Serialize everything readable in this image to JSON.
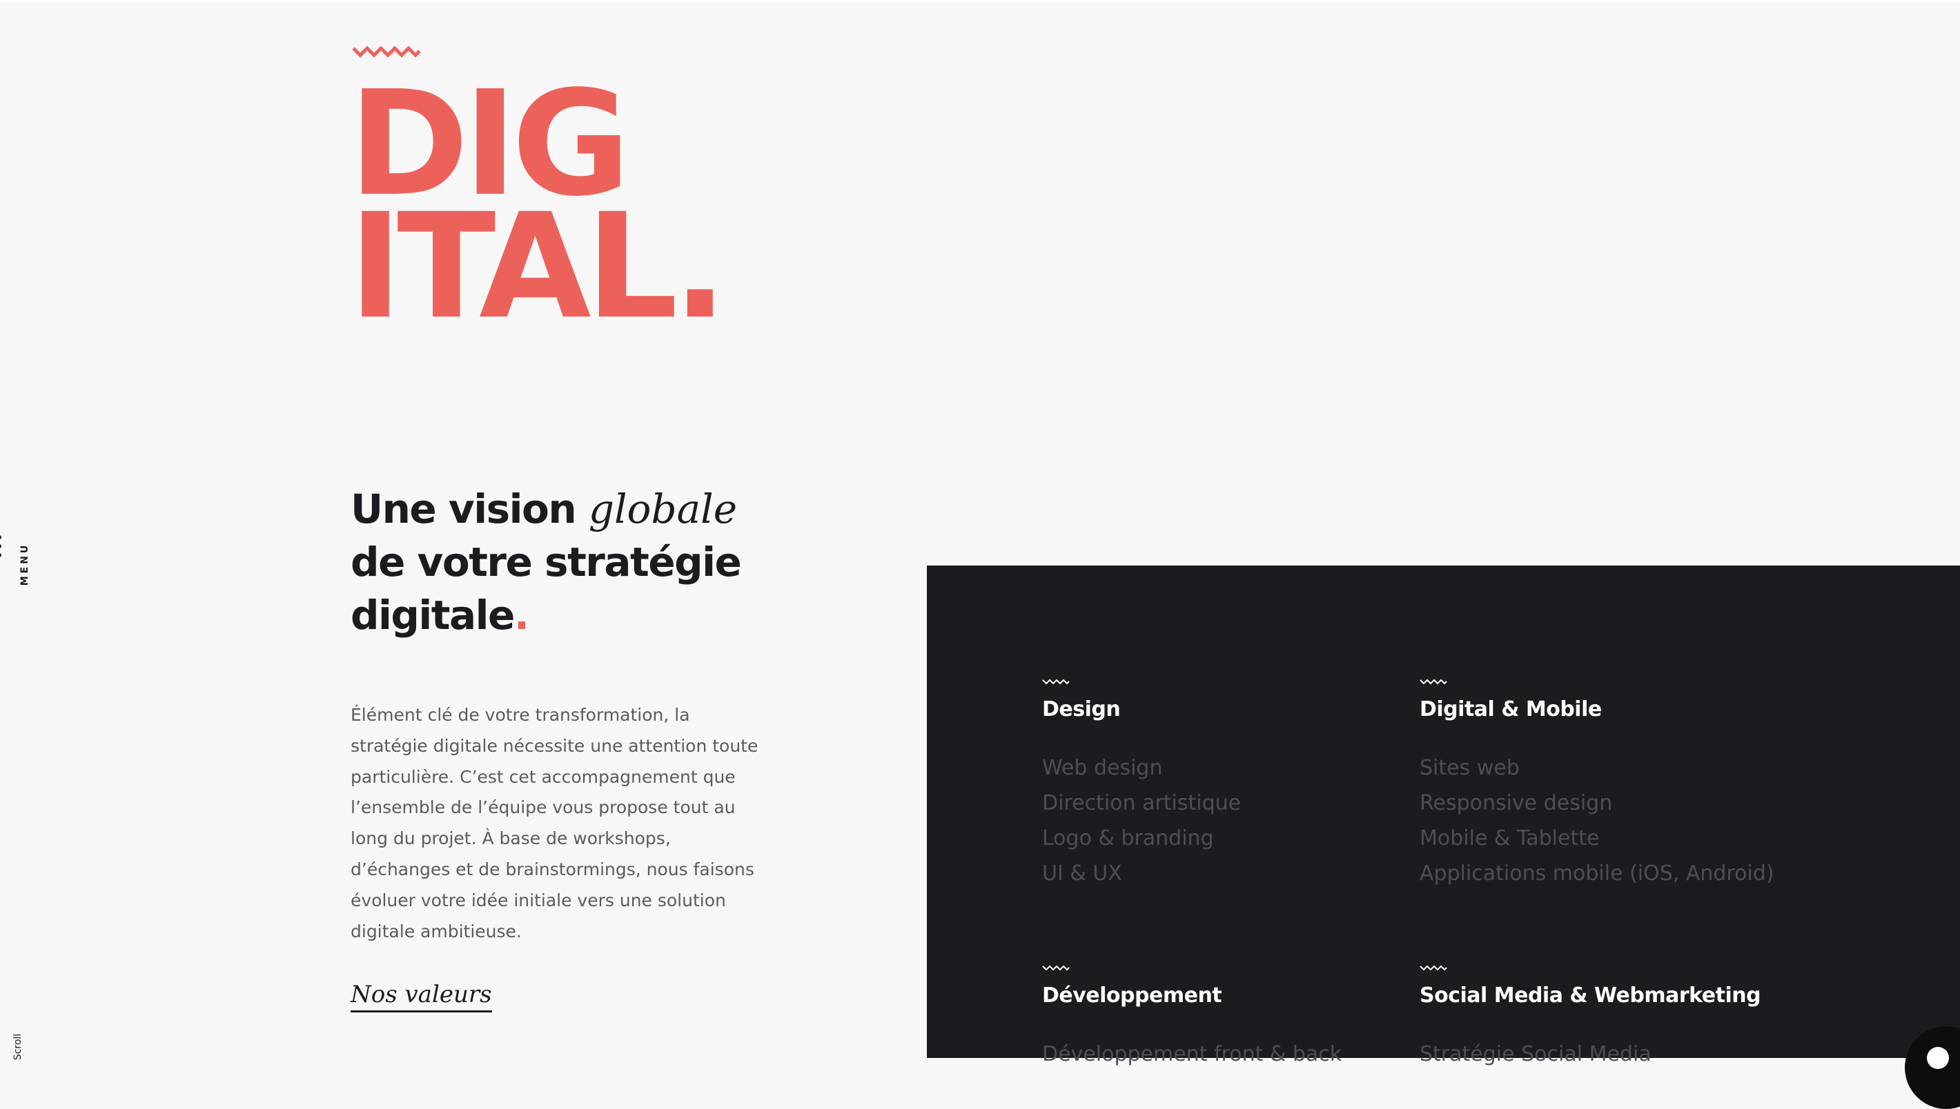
{
  "colors": {
    "accent": "#ec625b",
    "dark": "#1c1b20",
    "background": "#f7f7f7",
    "panel_text_muted": "#4f4e55"
  },
  "side": {
    "menu_icon": "menu-dots-icon",
    "menu_label": "MENU",
    "scroll_label": "Scroll"
  },
  "hero": {
    "line1": "DIG",
    "line2": "ITAL."
  },
  "vision": {
    "part1": "Une vision ",
    "italic": "globale",
    "part2": "de votre stratégie",
    "part3": "digitale",
    "dot": "."
  },
  "intro": {
    "text": "Élément clé de votre transformation, la stratégie digitale nécessite une attention toute particulière. C’est cet accompagnement que l’ensemble de l’équipe vous propose tout au long du projet. À base de workshops, d’échanges et de brainstormings, nous faisons évoluer votre idée initiale vers une solution digitale ambitieuse.",
    "link": "Nos valeurs"
  },
  "services": [
    {
      "title": "Design",
      "items": [
        "Web design",
        "Direction artistique",
        "Logo & branding",
        "UI & UX"
      ]
    },
    {
      "title": "Digital & Mobile",
      "items": [
        "Sites web",
        "Responsive design",
        "Mobile & Tablette",
        "Applications mobile (iOS, Android)"
      ]
    },
    {
      "title": "Développement",
      "items": [
        "Développement front & back"
      ]
    },
    {
      "title": "Social Media & Webmarketing",
      "items": [
        "Stratégie Social Media"
      ]
    }
  ]
}
